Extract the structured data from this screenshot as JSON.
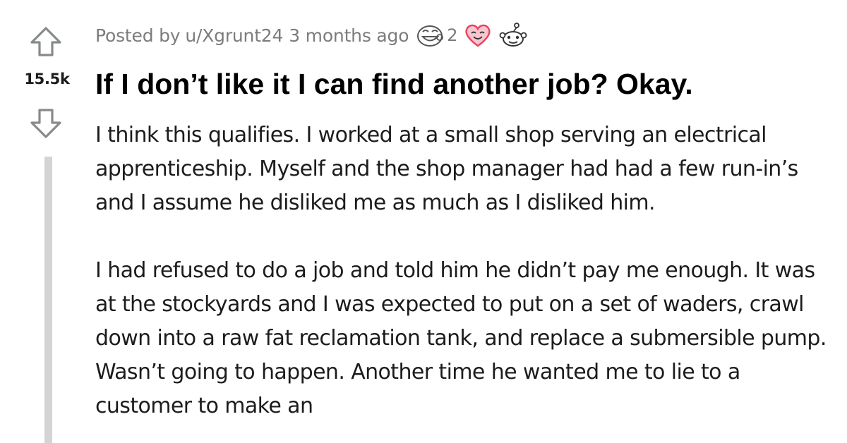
{
  "vote": {
    "score": "15.5k"
  },
  "post": {
    "posted_by": "Posted by",
    "author": "u/Xgrunt24",
    "time": "3 months ago",
    "awards": [
      {
        "icon": "grin-face-award-icon",
        "count": "2"
      },
      {
        "icon": "heart-eyes-award-icon",
        "count": ""
      },
      {
        "icon": "snoo-award-icon",
        "count": ""
      }
    ],
    "title": "If I don’t like it I can find another job? Okay.",
    "paragraphs": [
      "I think this qualifies. I worked at a small shop serving an electrical apprenticeship. Myself and the shop manager had had a few run-in’s and I assume he disliked me as much as I disliked him.",
      "I had refused to do a job and told him he didn’t pay me enough. It was at the stockyards and I was expected to put on a set of waders, crawl down into a raw fat reclamation tank, and replace a submersible pump. Wasn’t going to happen. Another time he wanted me to lie to a customer to make an"
    ]
  },
  "colors": {
    "meta_text": "#7c7c7c",
    "title_text": "#000000",
    "body_text": "#1c1c1c",
    "thread_line": "#d4d4d4",
    "vote_icon": "#878a8c",
    "heart_award": "#e8435d"
  }
}
